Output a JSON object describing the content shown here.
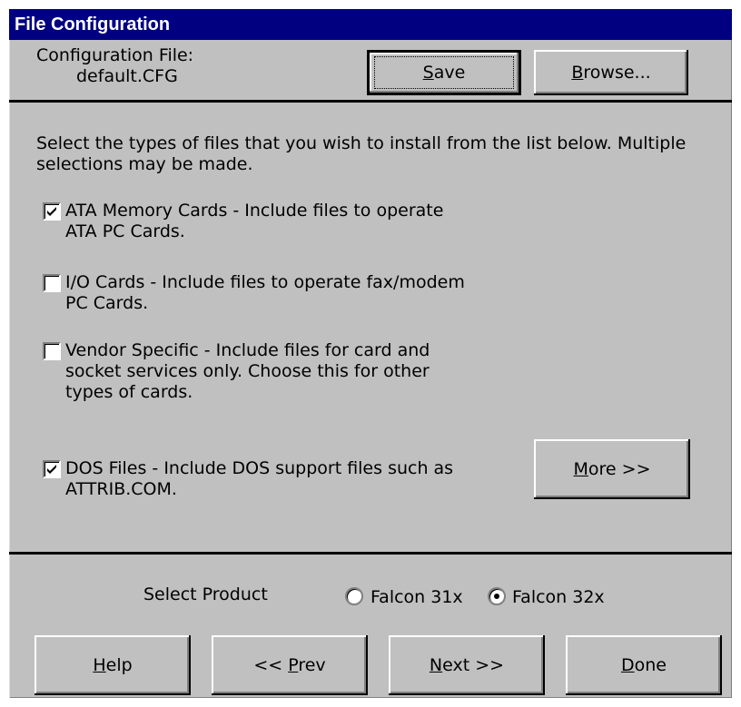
{
  "window": {
    "title": "File Configuration"
  },
  "config": {
    "label": "Configuration File:",
    "filename": "default.CFG"
  },
  "buttons": {
    "save": {
      "key": "S",
      "rest": "ave"
    },
    "browse": {
      "key": "B",
      "rest": "rowse..."
    },
    "more": {
      "key": "M",
      "rest": "ore >>"
    },
    "help": {
      "key": "H",
      "rest": "elp"
    },
    "prev": {
      "pre": "<< ",
      "key": "P",
      "rest": "rev"
    },
    "next": {
      "key": "N",
      "rest": "ext >>"
    },
    "done": {
      "key": "D",
      "rest": "one"
    }
  },
  "instructions": {
    "line1": "Select the types of files that you wish to install from the list below.  Multiple",
    "line2": "selections may be made."
  },
  "options": [
    {
      "checked": true,
      "lines": [
        "ATA Memory Cards - Include files to operate",
        "ATA PC Cards."
      ]
    },
    {
      "checked": false,
      "lines": [
        "I/O Cards - Include files to operate fax/modem",
        "PC Cards."
      ]
    },
    {
      "checked": false,
      "lines": [
        "Vendor Specific - Include files for card and",
        "socket services only.  Choose this for other",
        "types of cards."
      ]
    },
    {
      "checked": true,
      "lines": [
        "DOS Files - Include DOS support files such as",
        "ATTRIB.COM."
      ]
    }
  ],
  "product": {
    "label": "Select Product",
    "choices": [
      {
        "label": "Falcon 31x",
        "selected": false
      },
      {
        "label": "Falcon 32x",
        "selected": true
      }
    ]
  }
}
